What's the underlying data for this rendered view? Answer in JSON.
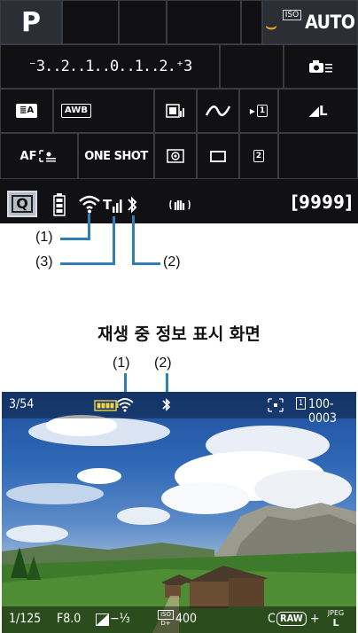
{
  "quick_control": {
    "mode": "P",
    "iso_badge": "ISO",
    "iso_value": "AUTO",
    "exposure_scale": "⁻3..2..1..0..1..2.⁺3",
    "picture_style": "≣A",
    "white_balance": "AWB",
    "af_mode_label": "AF",
    "af_operation": "ONE SHOT",
    "image_quality": "◢L",
    "slot_1": "1",
    "slot_2": "2",
    "q_button": "Q",
    "shots_remaining": "[9999]"
  },
  "callouts": {
    "c1": "(1)",
    "c2": "(2)",
    "c3": "(3)",
    "p1": "(1)",
    "p2": "(2)"
  },
  "heading": "재생 중 정보 표시 화면",
  "playback": {
    "frame_index": "3/54",
    "file_number": "100-0003",
    "shutter": "1/125",
    "aperture": "F8.0",
    "exposure_comp": "−⅓",
    "iso_value": "400",
    "iso_top": "ISO",
    "iso_bottom": "D+",
    "raw_label": "RAW",
    "c_prefix": "C",
    "jpeg_top": "JPEG",
    "jpeg_bottom": "L",
    "plus": "+"
  },
  "colors": {
    "callout_line": "#2e7fb8",
    "screen_bg": "#111114",
    "cell_border": "#3a3c44",
    "af_indicator": "#f0a020"
  }
}
